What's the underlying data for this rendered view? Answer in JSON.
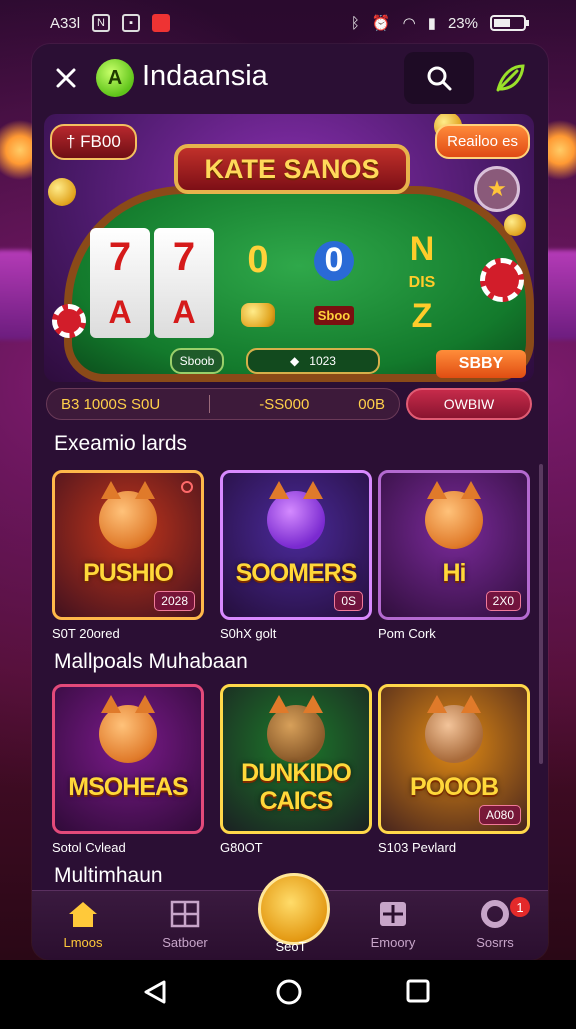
{
  "status_bar": {
    "time": "A33l",
    "battery_text": "23%"
  },
  "header": {
    "logo_letter": "A",
    "app_name": "Indaansia"
  },
  "hero": {
    "pill_left": "† FB00",
    "pill_right": "Reailoo es",
    "title": "KATE SANOS",
    "reel1": [
      "7",
      "A"
    ],
    "reel2": [
      "7",
      "A"
    ],
    "reel3": [
      "0"
    ],
    "reel4": [
      "0"
    ],
    "reel5_top": "N",
    "reel5_mid": "DIS",
    "reel5_bot": "Z",
    "sign": "Sboo",
    "btn_a": "Sboob",
    "btn_b": "1023",
    "play": "SBBY"
  },
  "info_strip": {
    "left": "B3 1000S S0U",
    "middle": "-SS000",
    "right": "00B"
  },
  "online_button": "OWBIW",
  "sections": [
    {
      "title": "Exeamio lards",
      "cards": [
        {
          "logo": "PUSHIO",
          "badge": "2028",
          "label": "S0T 20ored",
          "bg": "#c4361a",
          "border": "#ffb84a"
        },
        {
          "logo": "SOOMERS",
          "badge": "0S",
          "label": "S0hX golt",
          "bg": "#4a2a9a",
          "border": "#d88aff"
        },
        {
          "logo": "Hi",
          "badge": "2X0",
          "label": "Pom Cork",
          "bg": "#7a2a9a",
          "border": "#b46ad0"
        }
      ]
    },
    {
      "title": "Mallpoals Muhabaan",
      "cards": [
        {
          "logo": "MSOHEAS",
          "badge": "",
          "label": "Sotol Cvlead",
          "bg": "#7a1a8a",
          "border": "#e34a7a"
        },
        {
          "logo": "DUNKIDO CAICS",
          "badge": "",
          "label": "G80OT",
          "bg": "#1d7a2a",
          "border": "#ffd84a"
        },
        {
          "logo": "POOOB",
          "badge": "A080",
          "label": "S103 Pevlard",
          "bg": "#e08a14",
          "border": "#ffd84a"
        }
      ]
    }
  ],
  "third_section_title": "Multimhaun",
  "bottom_nav": [
    {
      "label": "Lmoos",
      "icon": "home-icon",
      "active": true
    },
    {
      "label": "Satboer",
      "icon": "grid-icon",
      "active": false
    },
    {
      "label": "SeoT",
      "icon": "mascot-icon",
      "active": false
    },
    {
      "label": "Emoory",
      "icon": "plus-box-icon",
      "active": false
    },
    {
      "label": "Sosrrs",
      "icon": "ring-icon",
      "active": false
    }
  ],
  "notif_count": "1"
}
